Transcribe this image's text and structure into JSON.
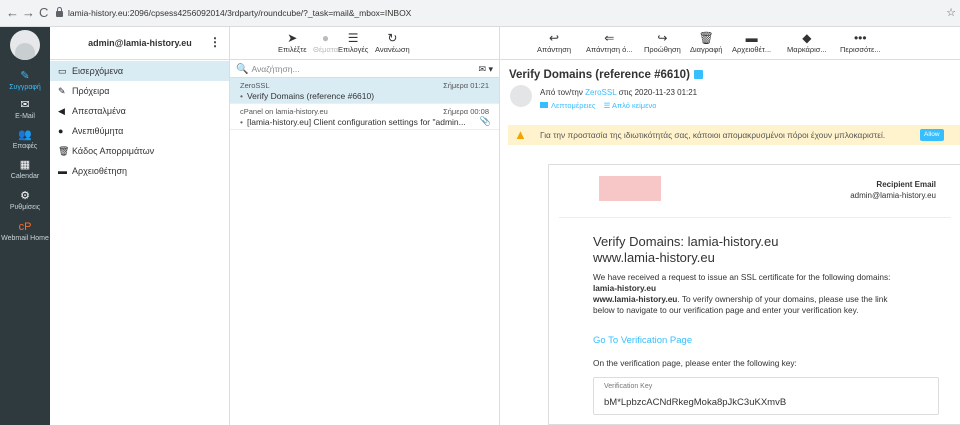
{
  "browser": {
    "url": "lamia-history.eu:2096/cpsess4256092014/3rdparty/roundcube/?_task=mail&_mbox=INBOX"
  },
  "tasknav": {
    "compose_label": "Συγγραφή",
    "email_label": "E-Mail",
    "contacts_label": "Επαφές",
    "calendar_label": "Calendar",
    "settings_label": "Ρυθμίσεις",
    "webmail_label": "Webmail Home"
  },
  "folders": {
    "account": "admin@lamia-history.eu",
    "items": [
      {
        "label": "Εισερχόμενα",
        "icon": "inbox-icon"
      },
      {
        "label": "Πρόχειρα",
        "icon": "pencil-icon"
      },
      {
        "label": "Απεσταλμένα",
        "icon": "send-icon"
      },
      {
        "label": "Ανεπιθύμητα",
        "icon": "spam-icon"
      },
      {
        "label": "Κάδος Απορριμάτων",
        "icon": "trash-icon"
      },
      {
        "label": "Αρχειοθέτηση",
        "icon": "archive-icon"
      }
    ]
  },
  "list_toolbar": {
    "select": "Επιλέξτε",
    "threads": "Θέματα",
    "options": "Επιλογές",
    "refresh": "Ανανέωση"
  },
  "search": {
    "placeholder": "Αναζήτηση..."
  },
  "messages": [
    {
      "from": "ZeroSSL",
      "date": "Σήμερα 01:21",
      "subject": "Verify Domains (reference #6610)"
    },
    {
      "from": "cPanel on lamia-history.eu",
      "date": "Σήμερα 00:08",
      "subject": "[lamia-history.eu] Client configuration settings for \"admin..."
    }
  ],
  "content_toolbar": {
    "reply": "Απάντηση",
    "reply_all": "Απάντηση ό...",
    "forward": "Προώθηση",
    "delete": "Διαγραφή",
    "archive": "Αρχειοθέτ...",
    "mark": "Μαρκάρισ...",
    "more": "Περισσότε..."
  },
  "message": {
    "subject": "Verify Domains (reference #6610)",
    "from_prefix": "Από τον/την",
    "from_name": "ZeroSSL",
    "from_suffix": "στις 2020-11-23 01:21",
    "details_link": "Λεπτομέρειες",
    "plain_link": "Απλό κείμενο",
    "remote_warning": "Για την προστασία της ιδιωτικότητάς σας, κάποιοι απομακρυσμένοι πόροι έχουν μπλοκαριστεί.",
    "allow_button": "Allow"
  },
  "mail_body": {
    "recipient_label": "Recipient Email",
    "recipient_value": "admin@lamia-history.eu",
    "heading_line1": "Verify Domains: lamia-history.eu",
    "heading_line2": "www.lamia-history.eu",
    "para1": "We have received a request to issue an SSL certificate for the following domains:",
    "domain1": "lamia-history.eu",
    "domain2": "www.lamia-history.eu",
    "para2a": ". To verify ownership of your domains, please use the link",
    "para2b": "below to navigate to our verification page and enter your verification key.",
    "link": "Go To Verification Page",
    "para3": "On the verification page, please enter the following key:",
    "key_label": "Verification Key",
    "key_value": "bM*LpbzcACNdRkegMoka8pJkC3uKXmvB"
  }
}
